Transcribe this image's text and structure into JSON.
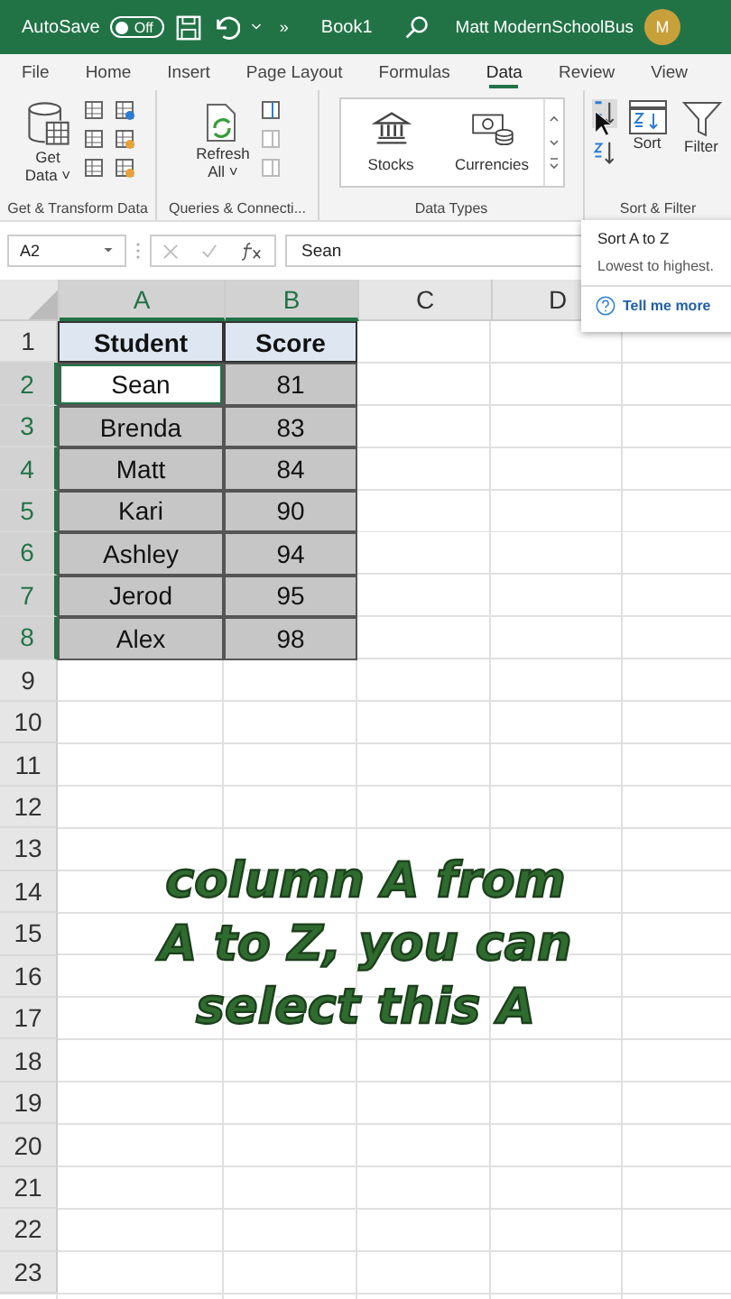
{
  "title_bar": {
    "autosave_label": "AutoSave",
    "autosave_toggle": {
      "label": "Off",
      "on": false
    },
    "more": "»",
    "title": "Book1",
    "user": "Matt ModernSchoolBus",
    "avatar": "M"
  },
  "tabs": [
    {
      "label": "File",
      "selected": false
    },
    {
      "label": "Home",
      "selected": false
    },
    {
      "label": "Insert",
      "selected": false
    },
    {
      "label": "Page Layout",
      "selected": false
    },
    {
      "label": "Formulas",
      "selected": false
    },
    {
      "label": "Data",
      "selected": true
    },
    {
      "label": "Review",
      "selected": false
    },
    {
      "label": "View",
      "selected": false
    }
  ],
  "ribbon": {
    "groups": [
      {
        "label": "Get & Transform Data",
        "big": [
          {
            "label": "Get",
            "label2": "Data ˅"
          }
        ],
        "kind": "get"
      },
      {
        "label": "Queries & Connecti...",
        "big": [
          {
            "label": "Refresh",
            "label2": "All ˅"
          }
        ],
        "kind": "refresh"
      },
      {
        "label": "Data Types",
        "big": [
          {
            "label": "Stocks"
          },
          {
            "label": "Currencies"
          }
        ],
        "kind": "types"
      },
      {
        "label": "Sort & Filter",
        "big": [
          {
            "label": "Sort"
          },
          {
            "label": "Filter"
          }
        ],
        "kind": "sort"
      }
    ]
  },
  "formula_bar": {
    "name_box": "A2",
    "value": "Sean"
  },
  "tooltip": {
    "title": "Sort A to Z",
    "description": "Lowest to highest.",
    "link": "Tell me more"
  },
  "sheet": {
    "columns": [
      {
        "label": "A",
        "selected": true
      },
      {
        "label": "B",
        "selected": true
      },
      {
        "label": "C",
        "selected": false
      },
      {
        "label": "D",
        "selected": false
      }
    ],
    "rows": [
      {
        "number": "1",
        "kind": "header",
        "selected": false,
        "cells": [
          {
            "text": "Student"
          },
          {
            "text": "Score"
          }
        ]
      },
      {
        "number": "2",
        "kind": "data",
        "selected": true,
        "cells": [
          {
            "text": "Sean",
            "active": true
          },
          {
            "text": "81",
            "active": false
          }
        ]
      },
      {
        "number": "3",
        "kind": "data",
        "selected": true,
        "cells": [
          {
            "text": "Brenda",
            "active": false
          },
          {
            "text": "83",
            "active": false
          }
        ]
      },
      {
        "number": "4",
        "kind": "data",
        "selected": true,
        "cells": [
          {
            "text": "Matt",
            "active": false
          },
          {
            "text": "84",
            "active": false
          }
        ]
      },
      {
        "number": "5",
        "kind": "data",
        "selected": true,
        "cells": [
          {
            "text": "Kari",
            "active": false
          },
          {
            "text": "90",
            "active": false
          }
        ]
      },
      {
        "number": "6",
        "kind": "data",
        "selected": true,
        "cells": [
          {
            "text": "Ashley",
            "active": false
          },
          {
            "text": "94",
            "active": false
          }
        ]
      },
      {
        "number": "7",
        "kind": "data",
        "selected": true,
        "cells": [
          {
            "text": "Jerod",
            "active": false
          },
          {
            "text": "95",
            "active": false
          }
        ]
      },
      {
        "number": "8",
        "kind": "data",
        "selected": true,
        "cells": [
          {
            "text": "Alex",
            "active": false
          },
          {
            "text": "98",
            "active": false
          }
        ]
      },
      {
        "number": "9",
        "kind": "empty",
        "selected": false
      },
      {
        "number": "10",
        "kind": "empty",
        "selected": false
      },
      {
        "number": "11",
        "kind": "empty",
        "selected": false
      },
      {
        "number": "12",
        "kind": "empty",
        "selected": false
      },
      {
        "number": "13",
        "kind": "empty",
        "selected": false
      },
      {
        "number": "14",
        "kind": "empty",
        "selected": false
      },
      {
        "number": "15",
        "kind": "empty",
        "selected": false
      },
      {
        "number": "16",
        "kind": "empty",
        "selected": false
      },
      {
        "number": "17",
        "kind": "empty",
        "selected": false
      },
      {
        "number": "18",
        "kind": "empty",
        "selected": false
      },
      {
        "number": "19",
        "kind": "empty",
        "selected": false
      },
      {
        "number": "20",
        "kind": "empty",
        "selected": false
      },
      {
        "number": "21",
        "kind": "empty",
        "selected": false
      },
      {
        "number": "22",
        "kind": "empty",
        "selected": false
      },
      {
        "number": "23",
        "kind": "empty",
        "selected": false
      }
    ]
  },
  "caption": [
    "column A from",
    "A to Z, you can",
    "select this A"
  ]
}
